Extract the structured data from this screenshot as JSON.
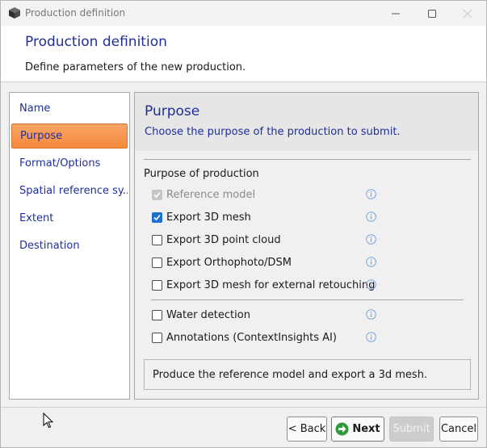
{
  "window": {
    "title": "Production definition"
  },
  "header": {
    "title": "Production definition",
    "description": "Define parameters of the new production."
  },
  "nav": {
    "items": [
      {
        "label": "Name",
        "active": false
      },
      {
        "label": "Purpose",
        "active": true
      },
      {
        "label": "Format/Options",
        "active": false
      },
      {
        "label": "Spatial reference sy...",
        "active": false
      },
      {
        "label": "Extent",
        "active": false
      },
      {
        "label": "Destination",
        "active": false
      }
    ]
  },
  "panel": {
    "title": "Purpose",
    "subtitle": "Choose the purpose of the production to submit.",
    "group_label": "Purpose of production",
    "options": [
      {
        "label": "Reference model",
        "checked": true,
        "disabled": true
      },
      {
        "label": "Export 3D mesh",
        "checked": true,
        "disabled": false
      },
      {
        "label": "Export 3D point cloud",
        "checked": false,
        "disabled": false
      },
      {
        "label": "Export Orthophoto/DSM",
        "checked": false,
        "disabled": false
      },
      {
        "label": "Export 3D mesh for external retouching",
        "checked": false,
        "disabled": false
      },
      {
        "label": "Water detection",
        "checked": false,
        "disabled": false
      },
      {
        "label": "Annotations (ContextInsights AI)",
        "checked": false,
        "disabled": false
      }
    ],
    "summary": "Produce the reference model and export a 3d mesh."
  },
  "buttons": {
    "back": "< Back",
    "next": "Next",
    "submit": "Submit",
    "cancel": "Cancel"
  },
  "colors": {
    "accent_blue": "#1f2f9a",
    "active_orange": "#f58a3c",
    "checkbox_blue": "#1a6fd0",
    "info_blue": "#7aa7d9"
  }
}
